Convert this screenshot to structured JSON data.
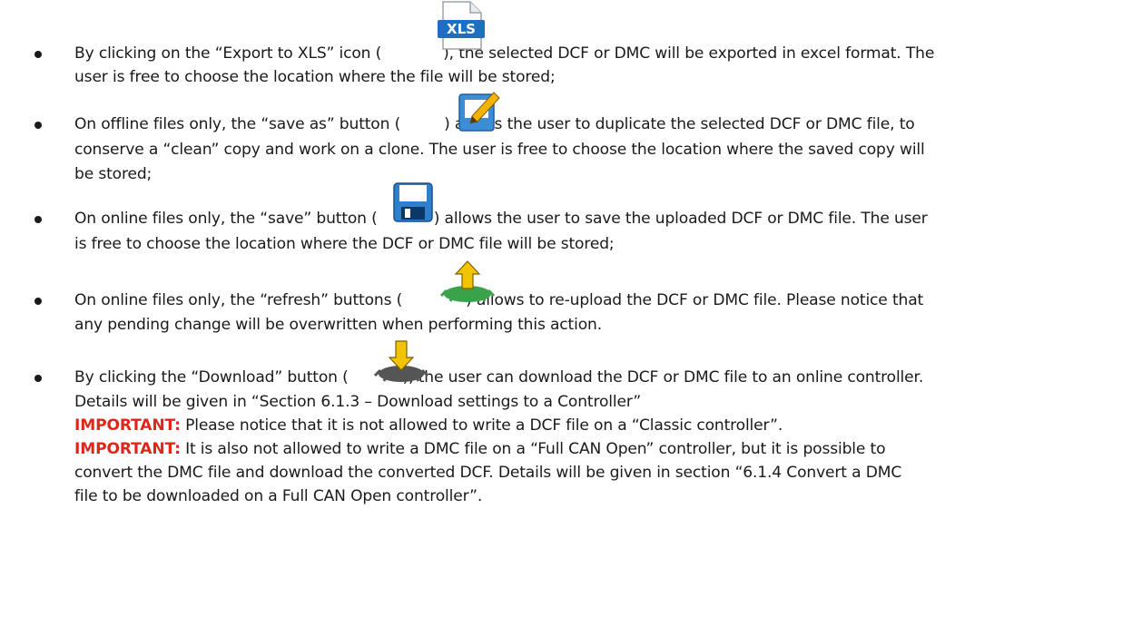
{
  "items": [
    {
      "lines": [
        [
          "By clicking on the “Export to XLS” icon (",
          "), the selected DCF or DMC will be exported in excel format. The"
        ],
        "user is free to choose the location where the file will be stored;"
      ],
      "icon": "xls-file-icon"
    },
    {
      "lines": [
        [
          "On offline files only, the “save as” button (",
          ") allows the user to duplicate the selected DCF or DMC file, to"
        ],
        "conserve a “clean” copy and work on a clone. The user is free to choose the location where the saved copy will",
        "be stored;"
      ],
      "icon": "save-as-pencil-icon"
    },
    {
      "lines": [
        [
          "On online files only, the “save” button (",
          ") allows the user to save the uploaded DCF or DMC file. The user"
        ],
        "is free to choose the location where the DCF or DMC file will be stored;"
      ],
      "icon": "floppy-disk-icon"
    },
    {
      "lines": [
        [
          "On online files only, the “refresh” buttons (",
          ") allows to re-upload the DCF or DMC file. Please notice that"
        ],
        "any pending change will be overwritten when performing this action."
      ],
      "icon": "chip-upload-icon"
    },
    {
      "lines": [
        [
          "By clicking the “Download” button (",
          "), the user can download the DCF or DMC file to an online controller."
        ],
        "Details will be given in “Section 6.1.3 – Download settings to a Controller”"
      ],
      "icon": "chip-download-icon",
      "important": [
        {
          "label": "IMPORTANT:",
          "lines": [
            "Please notice that it is not allowed to write a DCF file on a “Classic controller”."
          ]
        },
        {
          "label": "IMPORTANT:",
          "lines": [
            "It is also not allowed to write a DMC file on a “Full CAN Open” controller, but it is possible to",
            "convert the DMC file and download the converted DCF. Details will be given in section “6.1.4 Convert a DMC",
            "file to be downloaded on a Full CAN Open controller”."
          ]
        }
      ]
    }
  ],
  "colors": {
    "important": "#e0261b",
    "xls": "#1f6fc0",
    "chip_arrow": "#f2c300",
    "chip_green": "#3aa24a",
    "chip_gray": "#555555"
  }
}
